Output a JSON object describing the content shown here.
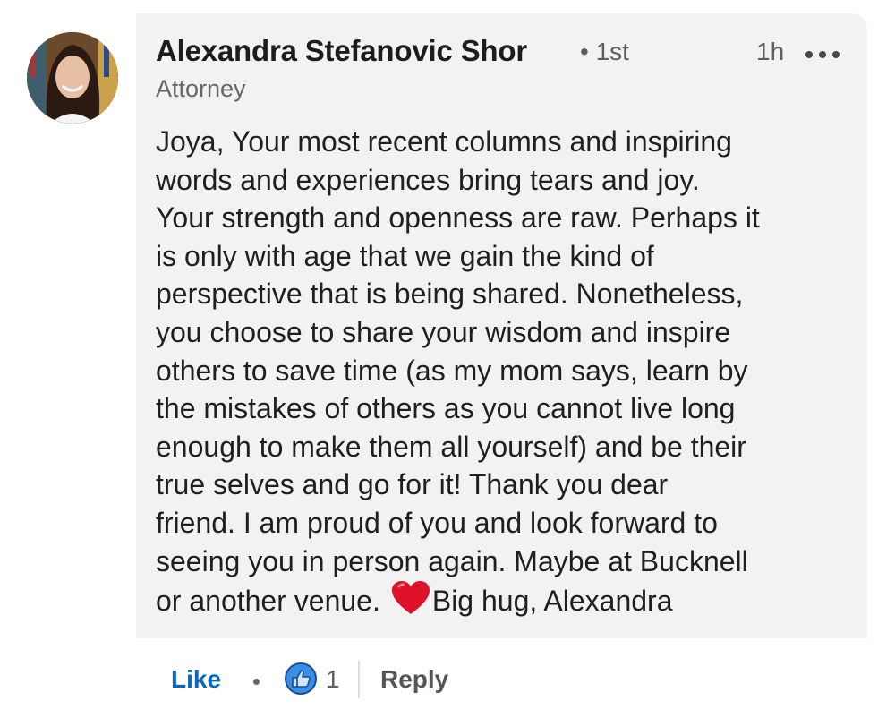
{
  "comment": {
    "author": {
      "name": "Alexandra Stefanovic Shor",
      "degree": "• 1st",
      "headline": "Attorney",
      "avatar": "profile-photo"
    },
    "time": "1h",
    "more_icon": "ellipsis-icon",
    "text_before_heart": "Joya, Your most recent columns and inspiring\nwords and experiences bring tears and joy.\nYour strength and openness are raw. Perhaps it\nis only with age that we gain the kind of\nperspective that is being shared. Nonetheless,\nyou choose to share your wisdom and inspire\nothers to save time (as my mom says, learn by\nthe mistakes of others as you cannot live long\nenough to make them all yourself) and be their\ntrue selves and go for it! Thank you dear\nfriend. I am proud of you and look forward to\nseeing you in person again. Maybe at Bucknell\nor another venue.",
    "heart_emoji": "red-heart-icon",
    "text_after_heart": "Big hug, Alexandra"
  },
  "actions": {
    "like_label": "Like",
    "reaction_icon": "thumbs-up-icon",
    "reaction_count": "1",
    "reply_label": "Reply"
  },
  "colors": {
    "like_blue": "#0a66c2",
    "bubble_bg": "#f2f2f2",
    "heart_red": "#e0122a"
  }
}
